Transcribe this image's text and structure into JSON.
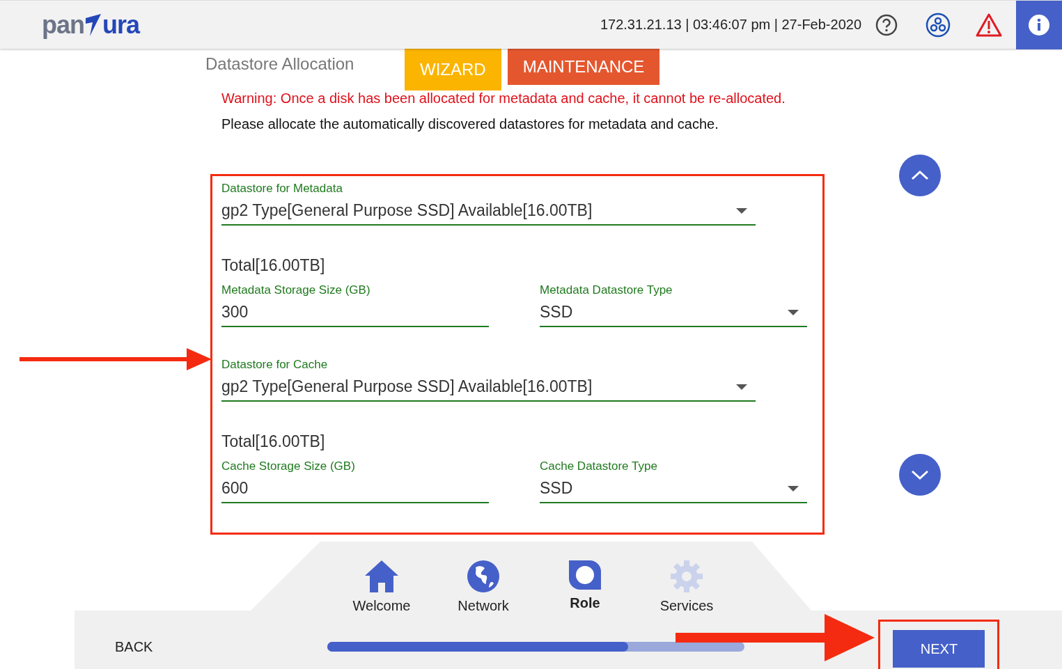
{
  "header": {
    "logo_left": "pan",
    "logo_right": "ura",
    "status": "172.31.21.13 | 03:46:07 pm | 27-Feb-2020"
  },
  "page": {
    "title": "Datastore Allocation",
    "mode_buttons": [
      {
        "label": "WIZARD",
        "selected": true
      },
      {
        "label": "MAINTENANCE",
        "selected": false
      }
    ],
    "warning": "Warning: Once a disk has been allocated for metadata and cache, it cannot be re-allocated.",
    "instructions": "Please allocate the automatically discovered datastores for metadata and cache."
  },
  "sections": [
    {
      "datastore": {
        "label": "Datastore for Metadata",
        "value": "gp2 Type[General Purpose SSD] Available[16.00TB]"
      },
      "total": "Total[16.00TB]",
      "size": {
        "label": "Metadata Storage Size (GB)",
        "value": "300"
      },
      "type": {
        "label": "Metadata Datastore Type",
        "value": "SSD"
      }
    },
    {
      "datastore": {
        "label": "Datastore for Cache",
        "value": "gp2 Type[General Purpose SSD] Available[16.00TB]"
      },
      "total": "Total[16.00TB]",
      "size": {
        "label": "Cache Storage Size (GB)",
        "value": "600"
      },
      "type": {
        "label": "Cache Datastore Type",
        "value": "SSD"
      }
    }
  ],
  "steps": [
    {
      "label": "Welcome",
      "kind": "home",
      "selected": false,
      "disabled": false
    },
    {
      "label": "Network",
      "kind": "globe",
      "selected": false,
      "disabled": false
    },
    {
      "label": "Role",
      "kind": "role",
      "selected": true,
      "disabled": false
    },
    {
      "label": "Services",
      "kind": "gear",
      "selected": false,
      "disabled": true
    }
  ],
  "footer": {
    "back": "BACK",
    "next": "NEXT",
    "progress": {
      "level": 0.72
    }
  }
}
